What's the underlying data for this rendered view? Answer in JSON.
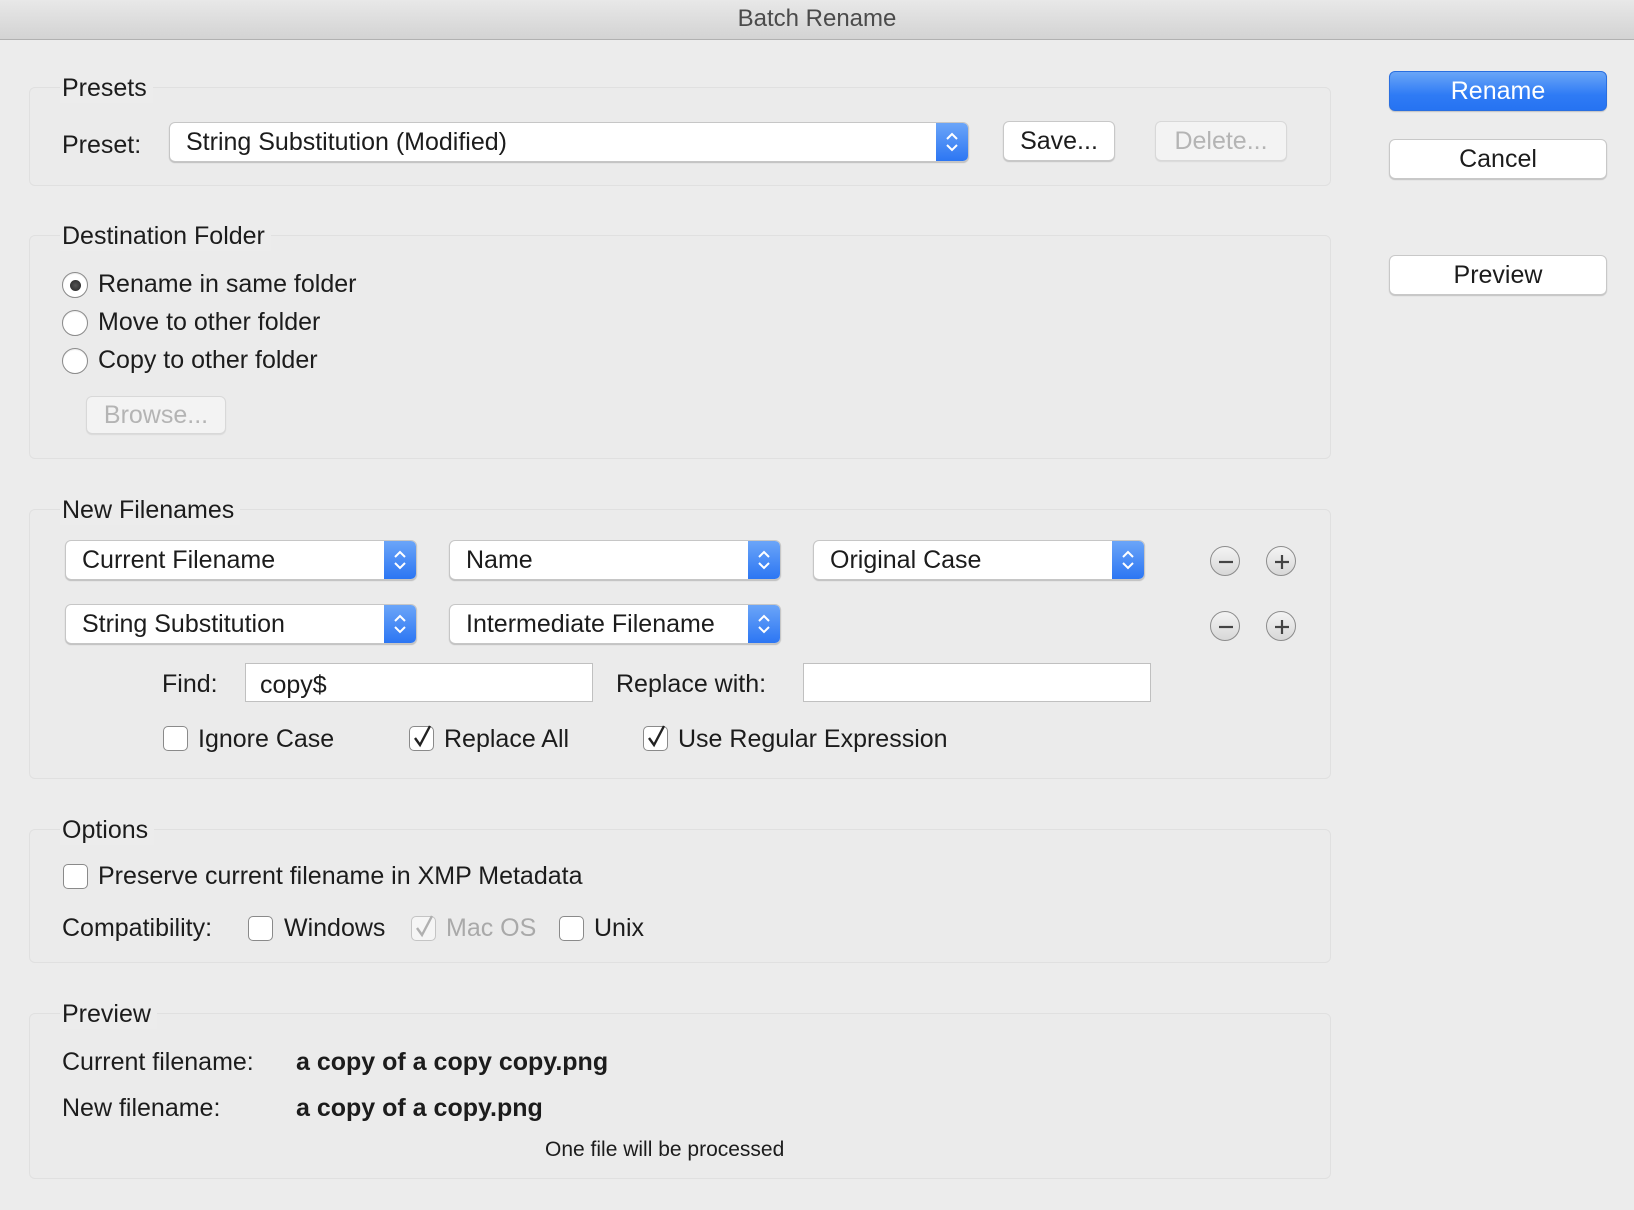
{
  "window": {
    "title": "Batch Rename"
  },
  "actions": {
    "rename": "Rename",
    "cancel": "Cancel",
    "preview": "Preview"
  },
  "presets": {
    "group_title": "Presets",
    "preset_label": "Preset:",
    "preset_value": "String Substitution (Modified)",
    "save_label": "Save...",
    "delete_label": "Delete..."
  },
  "destination": {
    "group_title": "Destination Folder",
    "options": [
      {
        "label": "Rename in same folder",
        "selected": true
      },
      {
        "label": "Move to other folder",
        "selected": false
      },
      {
        "label": "Copy to other folder",
        "selected": false
      }
    ],
    "browse_label": "Browse..."
  },
  "new_filenames": {
    "group_title": "New Filenames",
    "rows": [
      {
        "type": "Current Filename",
        "field": "Name",
        "case": "Original Case"
      },
      {
        "type": "String Substitution",
        "field": "Intermediate Filename"
      }
    ],
    "find_label": "Find:",
    "find_value": "copy$",
    "replace_label": "Replace with:",
    "replace_value": "",
    "ignore_case": {
      "label": "Ignore Case",
      "checked": false
    },
    "replace_all": {
      "label": "Replace All",
      "checked": true
    },
    "use_regex": {
      "label": "Use Regular Expression",
      "checked": true
    }
  },
  "options": {
    "group_title": "Options",
    "preserve": {
      "label": "Preserve current filename in XMP Metadata",
      "checked": false
    },
    "compat_label": "Compatibility:",
    "windows": {
      "label": "Windows",
      "checked": false
    },
    "macos": {
      "label": "Mac OS",
      "checked": true,
      "disabled": true
    },
    "unix": {
      "label": "Unix",
      "checked": false
    }
  },
  "preview": {
    "group_title": "Preview",
    "current_label": "Current filename:",
    "current_value": "a copy of a copy copy.png",
    "new_label": "New filename:",
    "new_value": "a copy of a copy.png",
    "status": "One file will be processed"
  },
  "colors": {
    "accent": "#2f7bf5",
    "background": "#ececec"
  }
}
